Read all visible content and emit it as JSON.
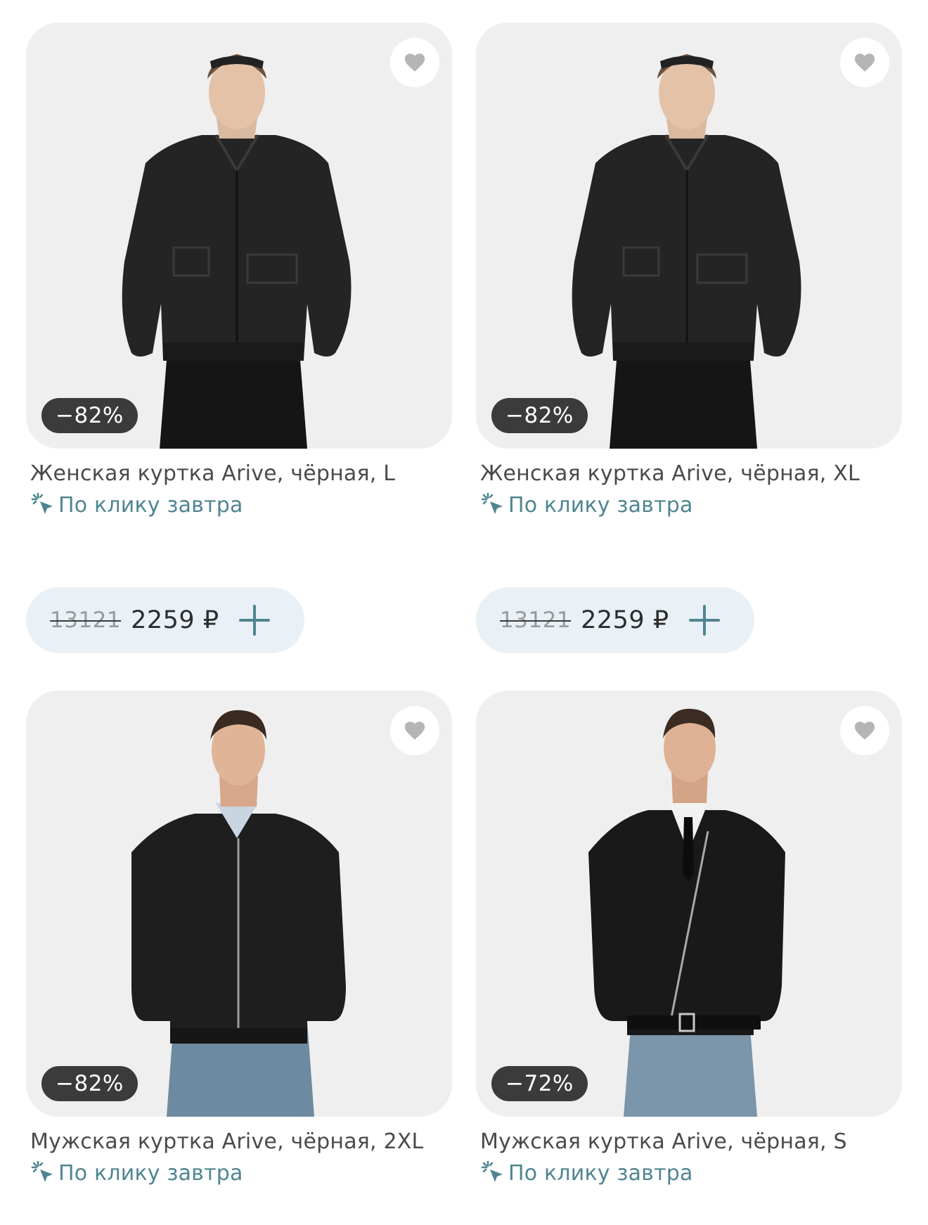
{
  "colors": {
    "card_bg": "#efefef",
    "badge_bg": "#3b3b3b",
    "delivery_text": "#4f8591",
    "price_pill_bg": "#e9f1f6",
    "plus_icon": "#4f8591",
    "heart_icon": "#b5b5b5"
  },
  "products": [
    {
      "title": "Женская куртка Arive, чёрная, L",
      "discount": "−82%",
      "delivery": "По клику завтра",
      "old_price": "13121",
      "price": "2259 ₽",
      "image_icon": "woman-leather-jacket-photo",
      "favorite_icon": "heart-icon",
      "add_icon": "plus-icon"
    },
    {
      "title": "Женская куртка Arive, чёрная, XL",
      "discount": "−82%",
      "delivery": "По клику завтра",
      "old_price": "13121",
      "price": "2259 ₽",
      "image_icon": "woman-leather-jacket-photo",
      "favorite_icon": "heart-icon",
      "add_icon": "plus-icon"
    },
    {
      "title": "Мужская куртка Arive, чёрная, 2XL",
      "discount": "−82%",
      "delivery": "По клику завтра",
      "image_icon": "man-bomber-jacket-photo",
      "favorite_icon": "heart-icon"
    },
    {
      "title": "Мужская куртка Arive, чёрная, S",
      "discount": "−72%",
      "delivery": "По клику завтра",
      "image_icon": "man-biker-jacket-photo",
      "favorite_icon": "heart-icon"
    }
  ]
}
